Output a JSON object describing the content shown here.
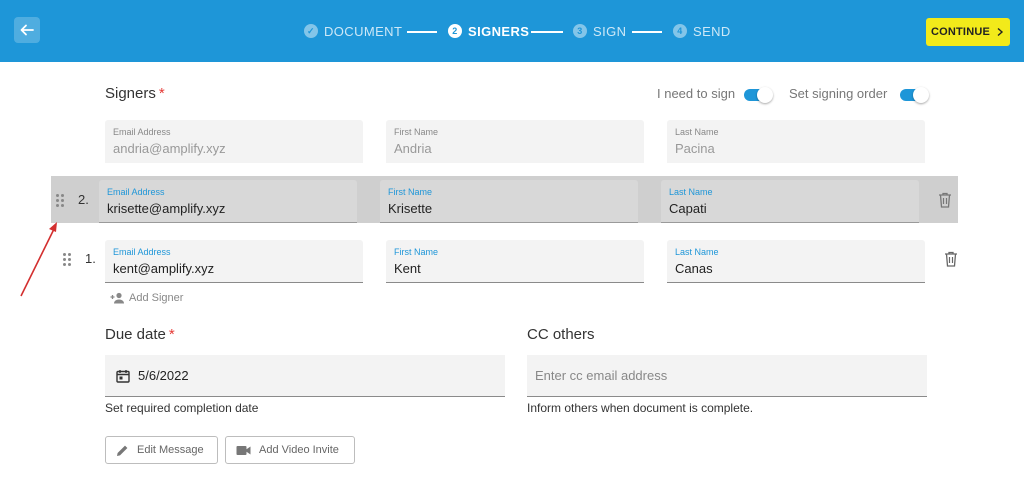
{
  "header": {
    "steps": [
      {
        "number": "✓",
        "label": "DOCUMENT"
      },
      {
        "number": "2",
        "label": "SIGNERS"
      },
      {
        "number": "3",
        "label": "SIGN"
      },
      {
        "number": "4",
        "label": "SEND"
      }
    ],
    "active_step": "SIGNERS",
    "continue_label": "CONTINUE"
  },
  "signers": {
    "title": "Signers",
    "required_mark": "*",
    "toggles": [
      {
        "label": "I need to sign",
        "on": true
      },
      {
        "label": "Set signing order",
        "on": true
      }
    ],
    "self_row": {
      "email": {
        "label": "Email Address",
        "value": "andria@amplify.xyz"
      },
      "first": {
        "label": "First Name",
        "value": "Andria"
      },
      "last": {
        "label": "Last Name",
        "value": "Pacina"
      }
    },
    "rows": [
      {
        "order": "2.",
        "email": {
          "label": "Email Address",
          "value": "krisette@amplify.xyz"
        },
        "first": {
          "label": "First Name",
          "value": "Krisette"
        },
        "last": {
          "label": "Last Name",
          "value": "Capati"
        }
      },
      {
        "order": "1.",
        "email": {
          "label": "Email Address",
          "value": "kent@amplify.xyz"
        },
        "first": {
          "label": "First Name",
          "value": "Kent"
        },
        "last": {
          "label": "Last Name",
          "value": "Canas"
        }
      }
    ],
    "add_signer_label": "Add Signer"
  },
  "due_date": {
    "title": "Due date",
    "required_mark": "*",
    "value": "5/6/2022",
    "helper": "Set required completion date"
  },
  "cc": {
    "title": "CC others",
    "placeholder": "Enter cc email address",
    "helper": "Inform others when document is complete."
  },
  "actions": {
    "edit_message_label": "Edit Message",
    "add_video_label": "Add Video Invite"
  },
  "colors": {
    "header_bg": "#1e96d8",
    "continue_bg": "#f2ea1a",
    "accent": "#1e96d8",
    "required": "#e53935",
    "annotation_arrow": "#d32f2f"
  }
}
